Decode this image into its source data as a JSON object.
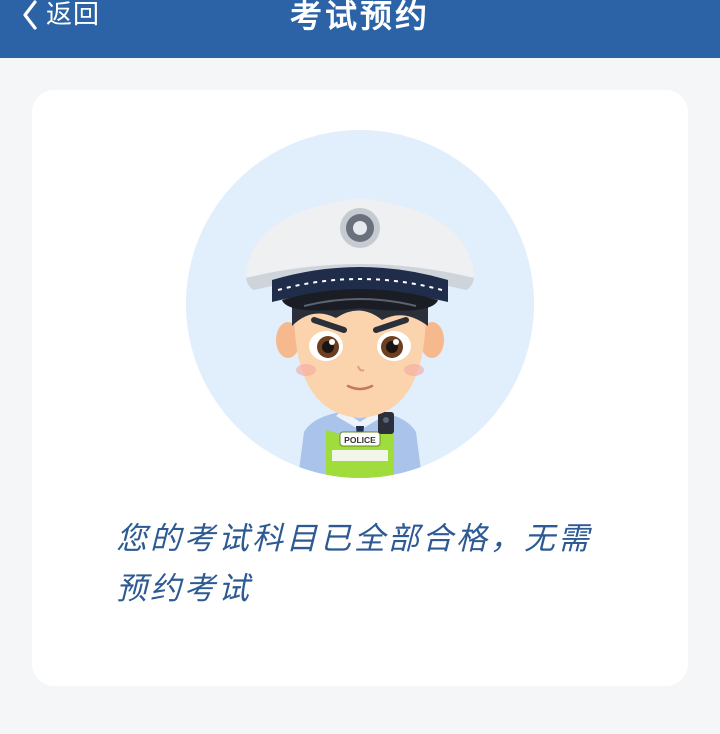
{
  "header": {
    "back_label": "返回",
    "title": "考试预约",
    "background": "#2b63a6"
  },
  "content": {
    "message": "您的考试科目已全部合格，无需预约考试",
    "avatar_icon": "police-officer-avatar",
    "badge_text": "POLICE"
  },
  "colors": {
    "page_background": "#f5f6f8",
    "card_background": "#ffffff",
    "avatar_background": "#e1eefc",
    "message_text": "#2d5a93"
  }
}
